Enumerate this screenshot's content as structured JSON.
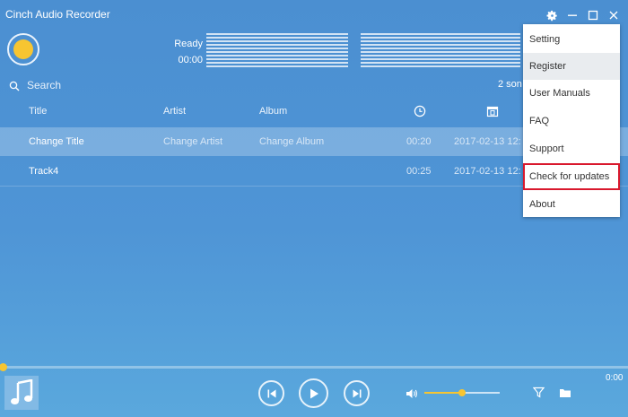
{
  "app": {
    "title": "Cinch Audio Recorder"
  },
  "recorder": {
    "status": "Ready",
    "time": "00:00"
  },
  "search": {
    "placeholder": "Search"
  },
  "song_count": "2 son",
  "columns": {
    "title": "Title",
    "artist": "Artist",
    "album": "Album"
  },
  "tracks": [
    {
      "title": "Change Title",
      "artist": "Change Artist",
      "album": "Change Album",
      "duration": "00:20",
      "date": "2017-02-13 12:",
      "selected": true
    },
    {
      "title": "Track4",
      "artist": "",
      "album": "",
      "duration": "00:25",
      "date": "2017-02-13 12:",
      "selected": false
    }
  ],
  "settings_menu": {
    "items": [
      "Setting",
      "Register",
      "User Manuals",
      "FAQ",
      "Support",
      "Check for updates",
      "About"
    ],
    "hovered": "Register",
    "highlighted": "Check for updates"
  },
  "player": {
    "elapsed": "0:00",
    "progress_percent": 0,
    "volume_percent": 50
  },
  "icons": {
    "window": [
      "gear-icon",
      "minimize-icon",
      "maximize-icon",
      "close-icon"
    ],
    "columns": [
      "clock-icon",
      "calendar-icon"
    ],
    "player": [
      "music-note-icon",
      "previous-icon",
      "play-icon",
      "next-icon",
      "volume-icon",
      "filter-icon",
      "folder-icon"
    ]
  },
  "colors": {
    "accent": "#f7c531",
    "background": "#4f95d6",
    "menu_highlight_border": "#d9182d"
  }
}
